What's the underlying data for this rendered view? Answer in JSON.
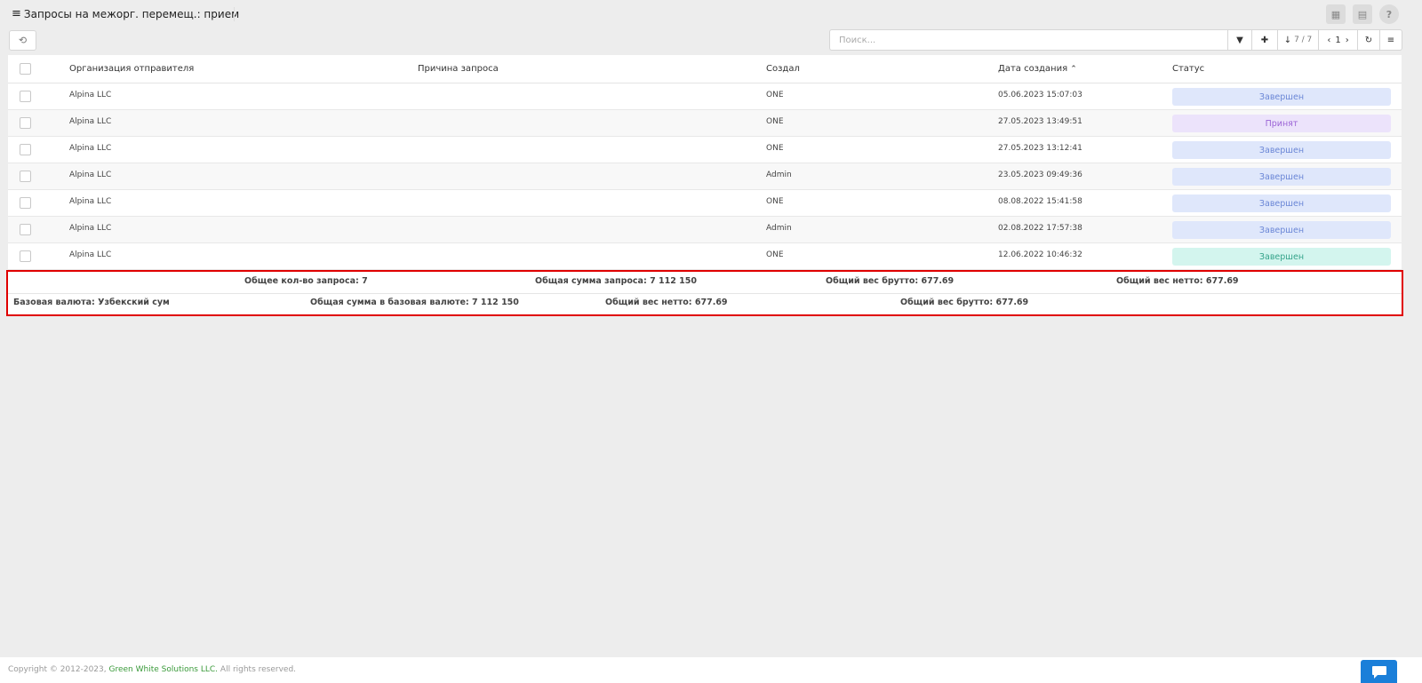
{
  "header": {
    "title": "Запросы на межорг. перемещ.: прием",
    "buttons": [
      {
        "icon": "calendar-icon",
        "glyph": "▦"
      },
      {
        "icon": "id-card-icon",
        "glyph": "▤"
      },
      {
        "icon": "help-icon",
        "glyph": "?"
      }
    ]
  },
  "toolbar": {
    "history_glyph": "⟲",
    "search_placeholder": "Поиск...",
    "sort_glyph": "↓",
    "count": "7 / 7",
    "page": "1",
    "filter_glyph": "▼",
    "pin_glyph": "✚",
    "refresh_glyph": "↻",
    "menu_glyph": "≡"
  },
  "table": {
    "columns": {
      "org": "Организация отправителя",
      "reason": "Причина запроса",
      "creator": "Создал",
      "date": "Дата создания",
      "date_sort": "⌃",
      "status": "Статус"
    },
    "rows": [
      {
        "org": "Alpina LLC",
        "reason": "",
        "creator": "ONE",
        "date": "05.06.2023 15:07:03",
        "status": "Завершен",
        "status_bg": "#dfe7fb",
        "status_fg": "#6a86d6"
      },
      {
        "org": "Alpina LLC",
        "reason": "",
        "creator": "ONE",
        "date": "27.05.2023 13:49:51",
        "status": "Принят",
        "status_bg": "#ece3fb",
        "status_fg": "#9b63d6"
      },
      {
        "org": "Alpina LLC",
        "reason": "",
        "creator": "ONE",
        "date": "27.05.2023 13:12:41",
        "status": "Завершен",
        "status_bg": "#dfe7fb",
        "status_fg": "#6a86d6"
      },
      {
        "org": "Alpina LLC",
        "reason": "",
        "creator": "Admin",
        "date": "23.05.2023 09:49:36",
        "status": "Завершен",
        "status_bg": "#dfe7fb",
        "status_fg": "#6a86d6"
      },
      {
        "org": "Alpina LLC",
        "reason": "",
        "creator": "ONE",
        "date": "08.08.2022 15:41:58",
        "status": "Завершен",
        "status_bg": "#dfe7fb",
        "status_fg": "#6a86d6"
      },
      {
        "org": "Alpina LLC",
        "reason": "",
        "creator": "Admin",
        "date": "02.08.2022 17:57:38",
        "status": "Завершен",
        "status_bg": "#dfe7fb",
        "status_fg": "#6a86d6"
      },
      {
        "org": "Alpina LLC",
        "reason": "",
        "creator": "ONE",
        "date": "12.06.2022 10:46:32",
        "status": "Завершен",
        "status_bg": "#d3f5ee",
        "status_fg": "#34a38a"
      }
    ]
  },
  "totals": {
    "total_count": "Общее кол-во запроса: 7",
    "total_sum": "Общая сумма запроса: 7 112 150",
    "gross_weight_1": "Общий вес брутто: 677.69",
    "net_weight_1": "Общий вес нетто: 677.69",
    "base_currency": "Базовая валюта: Узбекский сум",
    "sum_base_currency": "Общая сумма в базовая валюте: 7 112 150",
    "net_weight_2": "Общий вес нетто: 677.69",
    "gross_weight_2": "Общий вес брутто: 677.69"
  },
  "footer": {
    "copyright_prefix": "Copyright © 2012-2023,",
    "company": "Green White Solutions LLC.",
    "suffix": "All rights reserved."
  }
}
